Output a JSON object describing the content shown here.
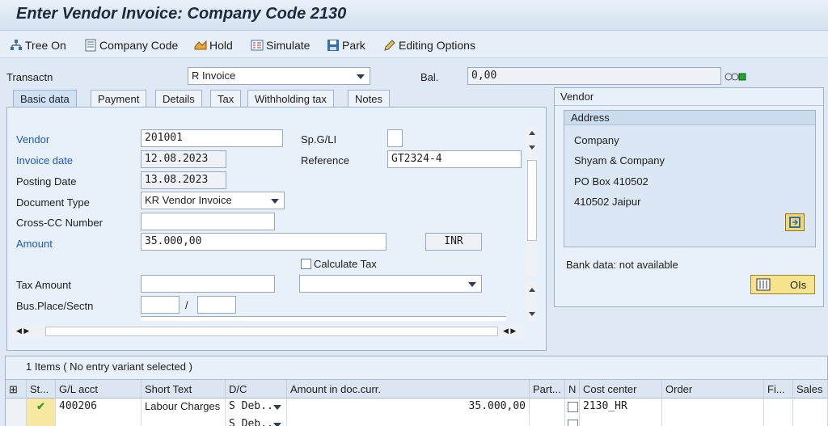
{
  "window": {
    "title": "Enter Vendor Invoice: Company Code 2130"
  },
  "toolbar": {
    "tree_on": "Tree On",
    "company_code": "Company Code",
    "hold": "Hold",
    "simulate": "Simulate",
    "park": "Park",
    "editing_options": "Editing Options"
  },
  "header": {
    "transaction_label": "Transactn",
    "transaction_value": "R Invoice",
    "balance_label": "Bal.",
    "balance_value": "0,00"
  },
  "tabs": [
    "Basic data",
    "Payment",
    "Details",
    "Tax",
    "Withholding tax",
    "Notes"
  ],
  "basic": {
    "vendor_label": "Vendor",
    "vendor_value": "201001",
    "spgl_label": "Sp.G/LI",
    "spgl_value": "",
    "invoice_date_label": "Invoice date",
    "invoice_date_value": "12.08.2023",
    "reference_label": "Reference",
    "reference_value": "GT2324-4",
    "posting_date_label": "Posting Date",
    "posting_date_value": "13.08.2023",
    "doc_type_label": "Document Type",
    "doc_type_value": "KR Vendor Invoice",
    "cross_cc_label": "Cross-CC Number",
    "cross_cc_value": "",
    "amount_label": "Amount",
    "amount_value": "35.000,00",
    "currency_value": "INR",
    "calc_tax_label": "Calculate Tax",
    "tax_amount_label": "Tax Amount",
    "tax_amount_value": "",
    "bus_place_label": "Bus.Place/Sectn",
    "bus_separator": "/"
  },
  "vendor_panel": {
    "title": "Vendor",
    "address_title": "Address",
    "address_lines": [
      "Company",
      "Shyam & Company",
      "PO Box 410502",
      "410502 Jaipur"
    ],
    "bank_data": "Bank data: not available",
    "ois_label": "OIs"
  },
  "items": {
    "summary": "1 Items ( No entry variant selected )",
    "columns": [
      "St...",
      "G/L acct",
      "Short Text",
      "D/C",
      "Amount in doc.curr.",
      "Part...",
      "N",
      "Cost center",
      "Order",
      "Fi...",
      "Sales"
    ],
    "rows": [
      {
        "gl": "400206",
        "short_text": "Labour Charges",
        "dc": "S Deb..",
        "amount": "35.000,00",
        "cost_center": "2130_HR"
      },
      {
        "gl": "",
        "short_text": "",
        "dc": "S Deb..",
        "amount": "",
        "cost_center": ""
      }
    ]
  },
  "colors": {
    "blue_label": "#1d58b8",
    "status_ok": "#3a9a2a"
  }
}
